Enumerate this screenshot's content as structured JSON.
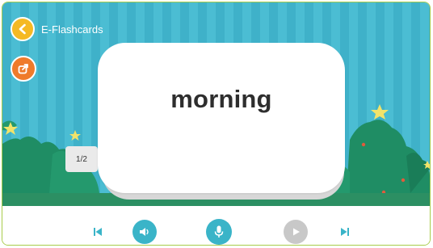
{
  "header": {
    "title": "E-Flashcards"
  },
  "card": {
    "word": "morning",
    "counter": "1/2"
  },
  "icons": {
    "back": "chevron-left-icon",
    "share": "share-icon",
    "prev": "skip-previous-icon",
    "audio": "speaker-icon",
    "mic": "microphone-icon",
    "play": "play-icon",
    "next": "skip-next-icon"
  },
  "colors": {
    "background": "#3fb1c9",
    "back_button": "#f5b924",
    "share_button": "#ef7b2b",
    "accent": "#3ab4c8",
    "disabled": "#c8c8c8",
    "border": "#a8cc4a"
  }
}
